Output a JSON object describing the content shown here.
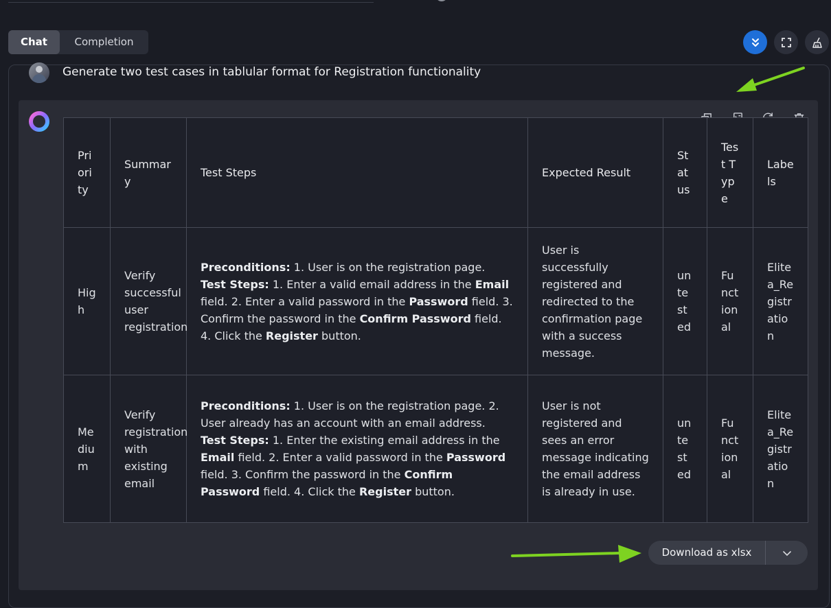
{
  "tabs": [
    {
      "label": "Chat",
      "active": true
    },
    {
      "label": "Completion",
      "active": false
    }
  ],
  "toolbar": {
    "icons": [
      "double-chevron-down-icon",
      "fullscreen-icon",
      "broom-icon"
    ],
    "accent": "#1f6fd8"
  },
  "prompt": {
    "text": "Generate two test cases in tablular format for Registration functionality"
  },
  "message_actions": [
    "copy-icon",
    "insert-icon",
    "regenerate-icon",
    "delete-icon"
  ],
  "table": {
    "headers": [
      "Priority",
      "Summary",
      "Test Steps",
      "Expected Result",
      "Status",
      "Test Type",
      "Labels"
    ],
    "rows": [
      {
        "priority": "High",
        "summary": "Verify successful user registration",
        "steps": {
          "pre_label": "Preconditions:",
          "pre_text": " 1. User is on the registration page. ",
          "ts_label": "Test Steps:",
          "s1": " 1. Enter a valid email address in the ",
          "f1": "Email",
          "s2": " field. 2. Enter a valid password in the ",
          "f2": "Password",
          "s3": " field. 3. Confirm the password in the ",
          "f3": "Confirm Password",
          "s4": " field. 4. Click the ",
          "f4": "Register",
          "s5": " button."
        },
        "expected": "User is successfully registered and redirected to the confirmation page with a success message.",
        "status": "untested",
        "type": "Functional",
        "labels": "Elitea_Registration"
      },
      {
        "priority": "Medium",
        "summary": "Verify registration with existing email",
        "steps": {
          "pre_label": "Preconditions:",
          "pre_text": " 1. User is on the registration page. 2. User already has an account with an email address. ",
          "ts_label": "Test Steps:",
          "s1": " 1. Enter the existing email address in the ",
          "f1": "Email",
          "s2": " field. 2. Enter a valid password in the ",
          "f2": "Password",
          "s3": " field. 3. Confirm the password in the ",
          "f3": "Confirm Password",
          "s4": " field. 4. Click the ",
          "f4": "Register",
          "s5": " button."
        },
        "expected": "User is not registered and sees an error message indicating the email address is already in use.",
        "status": "untested",
        "type": "Functional",
        "labels": "Elitea_Registration"
      }
    ]
  },
  "download": {
    "label": "Download as xlsx"
  },
  "annotation_color": "#7ed321"
}
